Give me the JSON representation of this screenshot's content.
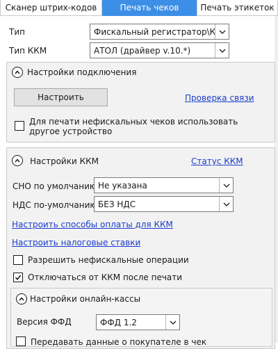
{
  "tabs": [
    {
      "label": "Сканер штрих-кодов",
      "active": false
    },
    {
      "label": "Печать чеков",
      "active": true
    },
    {
      "label": "Печать этикеток",
      "active": false
    }
  ],
  "type_row": {
    "label": "Тип",
    "value": "Фискальный регистратор\\ККМ"
  },
  "kkm_type_row": {
    "label": "Тип ККМ",
    "value": "АТОЛ (драйвер v.10.*)"
  },
  "connection": {
    "title": "Настройки подключения",
    "configure_button": "Настроить",
    "check_link": "Проверка связи",
    "other_device_label": "Для печати нефискальных чеков использовать другое устройство",
    "other_device_checked": false
  },
  "kkm_settings": {
    "title": "Настройки ККМ",
    "status_link": "Статус ККМ",
    "sno_label": "СНО по умолчанию",
    "sno_value": "Не указана",
    "nds_label": "НДС по-умолчанию",
    "nds_value": "БЕЗ НДС",
    "payment_methods_link": "Настроить способы оплаты для ККМ",
    "tax_rates_link": "Настроить налоговые ставки",
    "allow_nonfiscal_label": "Разрешить нефискальные операции",
    "allow_nonfiscal_checked": false,
    "disconnect_label": "Отключаться от ККМ после печати",
    "disconnect_checked": true
  },
  "online_kassa": {
    "title": "Настройки онлайн-кассы",
    "ffd_label": "Версия ФФД",
    "ffd_value": "ФФД 1.2",
    "buyer_data_label": "Передавать данные о покупателе в чек",
    "buyer_data_checked": false
  },
  "colors": {
    "accent": "#3d8ee6",
    "link": "#1a3ccc"
  }
}
